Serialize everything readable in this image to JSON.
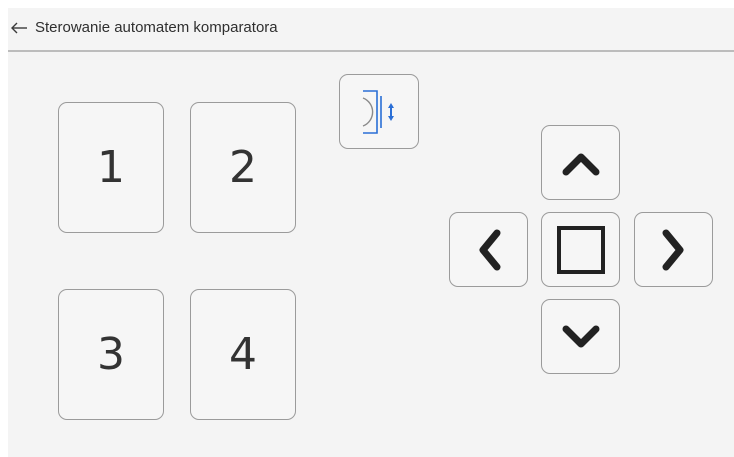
{
  "header": {
    "back_icon": "arrow-left-icon",
    "title": "Sterowanie automatem komparatora"
  },
  "positions": [
    {
      "label": "1"
    },
    {
      "label": "2"
    },
    {
      "label": "3"
    },
    {
      "label": "4"
    }
  ],
  "controls": {
    "lift_icon": "comparator-lift-icon",
    "up_icon": "chevron-up-icon",
    "left_icon": "chevron-left-icon",
    "center_icon": "square-stop-icon",
    "right_icon": "chevron-right-icon",
    "down_icon": "chevron-down-icon"
  },
  "colors": {
    "accent": "#2a6fd6",
    "background": "#f4f4f4",
    "border": "#9b9b9b",
    "icon": "#222222"
  }
}
